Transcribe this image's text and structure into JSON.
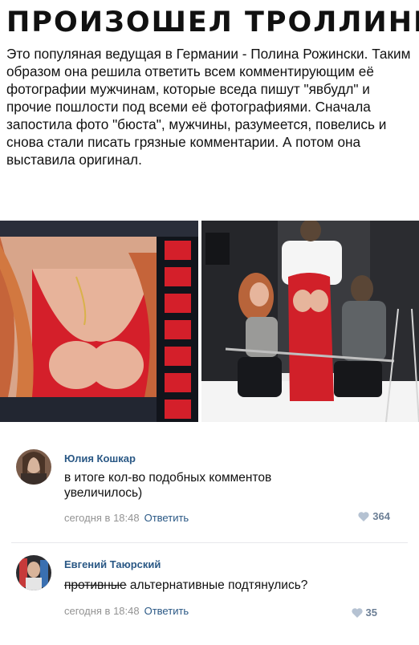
{
  "headline": "ПРОИЗОШЕЛ ТРОЛЛИНГ",
  "story": "Это популяная ведущая в Германии - Полина Рожински. Таким образом она решила ответить всем комментирующим её фотографии мужчинам, которые вседа пишут \"явбудл\" и прочие пошлости под всеми её фотографиями. Сначала запостила фото \"бюста\", мужчины, разумеется, повелись и снова стали писать грязные комментарии. А потом она выставила оригинал.",
  "comments": [
    {
      "author": "Юлия Кошкар",
      "text": "в итоге кол-во подобных комментов увеличилось)",
      "time": "сегодня в 18:48",
      "reply": "Ответить",
      "likes": "364"
    },
    {
      "author": "Евгений Таюрский",
      "text_struck": "противные",
      "text": " альтернативные подтянулись?",
      "time": "сегодня в 18:48",
      "reply": "Ответить",
      "likes": "35"
    }
  ],
  "colors": {
    "link": "#2a5885",
    "meta": "#939393",
    "like": "#6b7e95",
    "dress": "#d9262b"
  }
}
